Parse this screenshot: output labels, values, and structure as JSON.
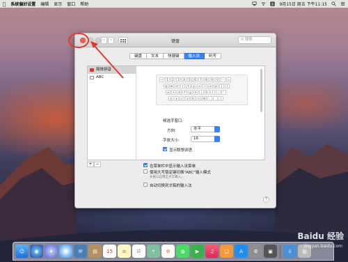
{
  "menubar": {
    "apple": "",
    "app_name": "系统偏好设置",
    "items": [
      "编辑",
      "显示",
      "窗口",
      "帮助"
    ],
    "clock": "9月15日 周五 下午11:15"
  },
  "window": {
    "title": "键盘",
    "search_placeholder": "搜索",
    "tabs": [
      "键盘",
      "文本",
      "快捷键",
      "输入法",
      "听写"
    ],
    "active_tab": "输入法"
  },
  "sources": [
    {
      "label": "简体拼音",
      "selected": true
    },
    {
      "label": "ABC",
      "selected": false
    }
  ],
  "keyboard_rows": [
    [
      "~",
      "1",
      "2",
      "3",
      "4",
      "5",
      "6",
      "7",
      "8",
      "9",
      "0",
      "-",
      "="
    ],
    [
      "q",
      "w",
      "e",
      "r",
      "t",
      "y",
      "u",
      "i",
      "o",
      "p",
      "[",
      "]"
    ],
    [
      "a",
      "s",
      "d",
      "f",
      "g",
      "h",
      "j",
      "k",
      "l",
      ";",
      "'"
    ],
    [
      "z",
      "x",
      "c",
      "v",
      "b",
      "n",
      "m",
      ",",
      ".",
      "/"
    ]
  ],
  "candidate_window": {
    "title": "候选字窗口:",
    "direction_label": "方向:",
    "direction_value": "水平",
    "font_size_label": "字体大小:",
    "font_size_value": "16",
    "show_predictions_label": "显示联想词语",
    "show_predictions_checked": true
  },
  "bottom_options": {
    "show_in_menu_bar": "在菜单栏中显示输入法菜单",
    "show_in_menu_bar_checked": true,
    "capslock_switch": "使用大写锁定键切换\"ABC\"输入模式",
    "capslock_switch_checked": false,
    "capslock_hint": "长按以启用全大写输入。",
    "auto_switch": "自动切换到文稿的输入法",
    "auto_switch_checked": false
  },
  "plus": "+",
  "minus": "−",
  "help": "?",
  "watermark": "Baidu 经验",
  "watermark_sub": "jingyan.baidu.com",
  "colors": {
    "accent": "#3a83f5",
    "close": "#fc5f57",
    "annotation": "#e23a2a"
  }
}
